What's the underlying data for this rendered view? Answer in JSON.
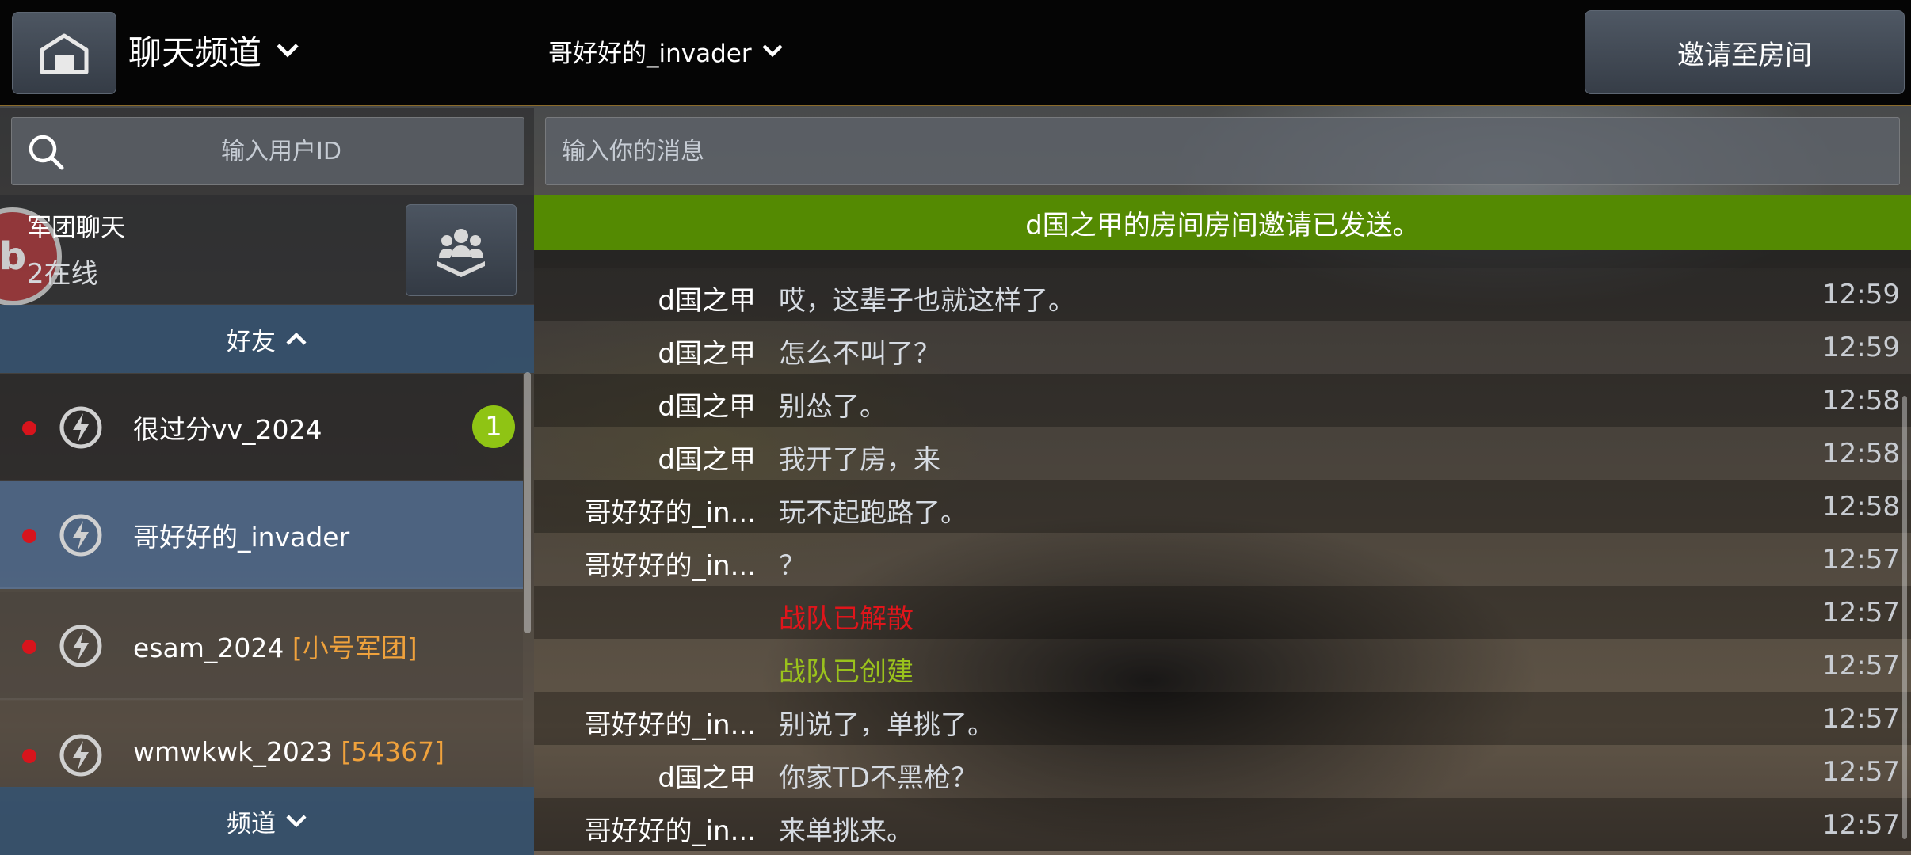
{
  "header": {
    "channel_title": "聊天频道",
    "chat_target": "哥好好的_invader",
    "invite_button": "邀请至房间"
  },
  "left": {
    "user_search_placeholder": "输入用户ID",
    "guild": {
      "name": "军团聊天",
      "online": "2在线"
    },
    "friends_header": "好友",
    "friends": [
      {
        "name": "很过分vv_2024",
        "tag": "",
        "unread": "1",
        "selected": false
      },
      {
        "name": "哥好好的_invader",
        "tag": "",
        "unread": "",
        "selected": true
      },
      {
        "name": "esam_2024 ",
        "tag": "[小号军团]",
        "unread": "",
        "selected": false
      },
      {
        "name": "wmwkwk_2023 ",
        "tag": "[54367]",
        "unread": "",
        "selected": false
      }
    ],
    "channels_header": "频道"
  },
  "right": {
    "message_placeholder": "输入你的消息",
    "notice": "d国之甲的房间房间邀请已发送。",
    "messages": [
      {
        "sender": "d国之甲",
        "text": "哎，这辈子也就这样了。",
        "time": "12:59",
        "style": "normal"
      },
      {
        "sender": "d国之甲",
        "text": "怎么不叫了？",
        "time": "12:59",
        "style": "normal"
      },
      {
        "sender": "d国之甲",
        "text": "别怂了。",
        "time": "12:58",
        "style": "normal"
      },
      {
        "sender": "d国之甲",
        "text": "我开了房，来",
        "time": "12:58",
        "style": "normal"
      },
      {
        "sender": "哥好好的_in...",
        "text": "玩不起跑路了。",
        "time": "12:58",
        "style": "normal"
      },
      {
        "sender": "哥好好的_in...",
        "text": "？",
        "time": "12:57",
        "style": "normal"
      },
      {
        "sender": "",
        "text": "战队已解散",
        "time": "12:57",
        "style": "red"
      },
      {
        "sender": "",
        "text": "战队已创建",
        "time": "12:57",
        "style": "green"
      },
      {
        "sender": "哥好好的_in...",
        "text": "别说了，单挑了。",
        "time": "12:57",
        "style": "normal"
      },
      {
        "sender": "d国之甲",
        "text": "你家TD不黑枪？",
        "time": "12:57",
        "style": "normal"
      },
      {
        "sender": "哥好好的_in...",
        "text": "来单挑来。",
        "time": "12:57",
        "style": "normal"
      }
    ]
  },
  "colors": {
    "notice_bg": "#548a02",
    "unread_badge": "#8fc414",
    "online_dot": "#d8141c",
    "guild_tag": "#f0a23c",
    "system_red": "#e0151b",
    "system_green": "#9ac21c",
    "selected_row": "#4e688c"
  }
}
